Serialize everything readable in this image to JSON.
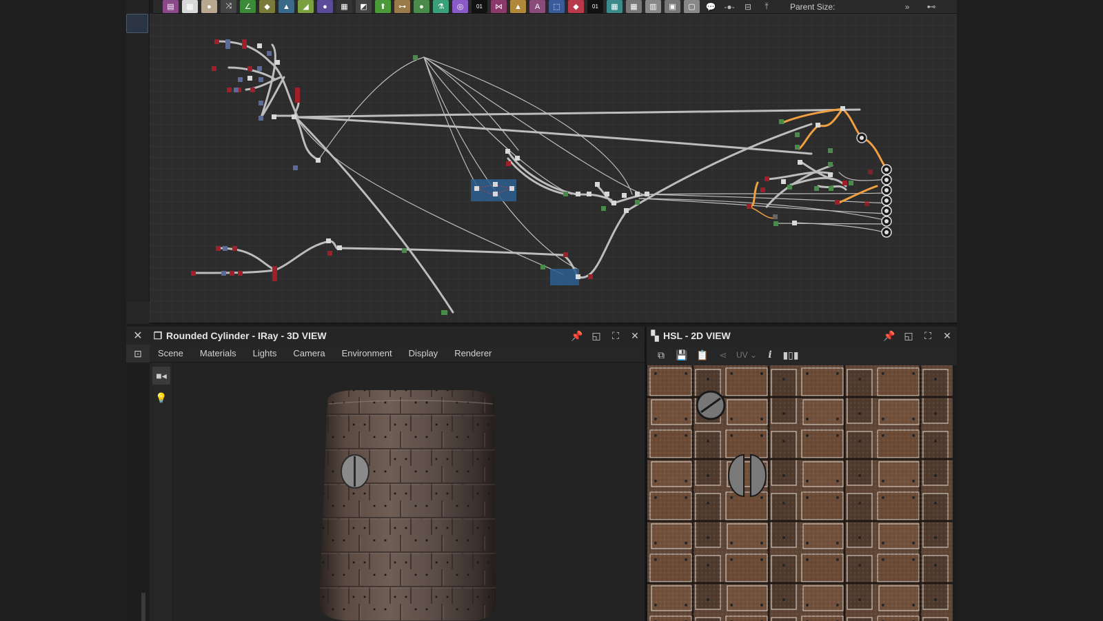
{
  "toolbar": {
    "icons": [
      {
        "name": "bitmap-icon",
        "color": "#8a4a8a",
        "glyph": "▤"
      },
      {
        "name": "svg-icon",
        "color": "#d8d8d8",
        "glyph": "▦"
      },
      {
        "name": "drop-icon",
        "color": "#b8a890",
        "glyph": "●"
      },
      {
        "name": "shuffle-icon",
        "color": "#444",
        "glyph": "⤨"
      },
      {
        "name": "curve-icon",
        "color": "#3a8a3a",
        "glyph": "∠"
      },
      {
        "name": "color-drop-icon",
        "color": "#7a7a3a",
        "glyph": "◆"
      },
      {
        "name": "levels-icon",
        "color": "#3a6a8a",
        "glyph": "▲"
      },
      {
        "name": "gradient-map-icon",
        "color": "#7aa040",
        "glyph": "◢"
      },
      {
        "name": "sphere-icon",
        "color": "#5a4a9a",
        "glyph": "●"
      },
      {
        "name": "grid-icon",
        "color": "#333",
        "glyph": "▦"
      },
      {
        "name": "blend-icon",
        "color": "#444",
        "glyph": "◩"
      },
      {
        "name": "tree-icon",
        "color": "#4a9a3a",
        "glyph": "⬆"
      },
      {
        "name": "node-link-icon",
        "color": "#9a7a4a",
        "glyph": "⊶"
      },
      {
        "name": "green-ball-icon",
        "color": "#4a8a4a",
        "glyph": "●"
      },
      {
        "name": "flask-icon",
        "color": "#3aa07a",
        "glyph": "⚗"
      },
      {
        "name": "color-wheel-icon",
        "color": "#8a5ac8",
        "glyph": "◎"
      },
      {
        "name": "fx-map-icon",
        "color": "#111",
        "glyph": "01"
      },
      {
        "name": "warp-icon",
        "color": "#8a3a6a",
        "glyph": "⋈"
      },
      {
        "name": "triangle-icon",
        "color": "#b08a3a",
        "glyph": "▲"
      },
      {
        "name": "text-icon",
        "color": "#8a4a7a",
        "glyph": "A"
      },
      {
        "name": "transform-icon",
        "color": "#3a5a9a",
        "glyph": "⬚"
      },
      {
        "name": "paint-bucket-icon",
        "color": "#b83a4a",
        "glyph": "◆"
      },
      {
        "name": "pixel-processor-icon",
        "color": "#111",
        "glyph": "01"
      },
      {
        "name": "normal-map-icon",
        "color": "#3a8a8a",
        "glyph": "▦"
      },
      {
        "name": "graph-icon-1",
        "color": "#777",
        "glyph": "▦"
      },
      {
        "name": "graph-icon-2",
        "color": "#888",
        "glyph": "▥"
      },
      {
        "name": "graph-icon-3",
        "color": "#777",
        "glyph": "▣"
      },
      {
        "name": "graph-icon-4",
        "color": "#888",
        "glyph": "▢"
      }
    ],
    "comment_label": "💬",
    "slider_label": "-●-",
    "frame_label": "⊟",
    "pin_label": "⤒",
    "parent_size_label": "Parent Size:",
    "more_label": "»",
    "link_label": "⊷"
  },
  "view3d": {
    "title": "Rounded Cylinder - IRay - 3D VIEW",
    "menu": [
      "Scene",
      "Materials",
      "Lights",
      "Camera",
      "Environment",
      "Display",
      "Renderer"
    ]
  },
  "view2d": {
    "title": "HSL - 2D VIEW",
    "uv_label": "UV"
  },
  "colors": {
    "node_red": "#a0202a",
    "node_blue": "#5a6a9a",
    "node_green": "#4a8a4a",
    "node_white": "#d8d8d8",
    "wire": "#bdbdbd",
    "wire_selected": "#f0a040",
    "frame_selection": "#2d5f8f"
  }
}
